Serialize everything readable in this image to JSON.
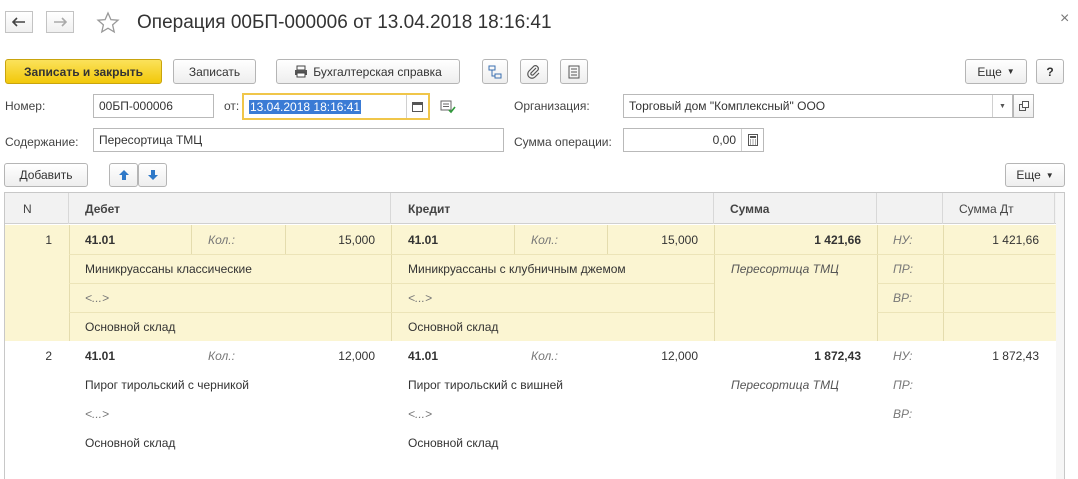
{
  "window": {
    "title": "Операция 00БП-000006 от 13.04.2018 18:16:41",
    "close": "×"
  },
  "toolbar": {
    "save_close": "Записать и закрыть",
    "save": "Записать",
    "accounting_report": "Бухгалтерская справка",
    "more": "Еще",
    "help": "?"
  },
  "form": {
    "number_label": "Номер:",
    "number_value": "00БП-000006",
    "date_label": "от:",
    "date_value": "13.04.2018 18:16:41",
    "org_label": "Организация:",
    "org_value": "Торговый дом \"Комплексный\" ООО",
    "content_label": "Содержание:",
    "content_value": "Пересортица ТМЦ",
    "sum_label": "Сумма операции:",
    "sum_value": "0,00"
  },
  "table_toolbar": {
    "add": "Добавить",
    "more": "Еще"
  },
  "table": {
    "headers": {
      "n": "N",
      "debit": "Дебет",
      "credit": "Кредит",
      "sum": "Сумма",
      "sum_dt": "Сумма Дт"
    },
    "qty_label": "Кол.:",
    "nu_label": "НУ:",
    "pr_label": "ПР:",
    "vr_label": "ВР:",
    "rows": [
      {
        "n": "1",
        "debit_account": "41.01",
        "debit_qty": "15,000",
        "debit_item": "Миникруассаны классические",
        "debit_sub2": "<...>",
        "debit_warehouse": "Основной склад",
        "credit_account": "41.01",
        "credit_qty": "15,000",
        "credit_item": "Миникруассаны с клубничным джемом",
        "credit_sub2": "<...>",
        "credit_warehouse": "Основной склад",
        "sum": "1 421,66",
        "sum_content": "Пересортица ТМЦ",
        "sum_dt": "1 421,66"
      },
      {
        "n": "2",
        "debit_account": "41.01",
        "debit_qty": "12,000",
        "debit_item": "Пирог тирольский с черникой",
        "debit_sub2": "<...>",
        "debit_warehouse": "Основной склад",
        "credit_account": "41.01",
        "credit_qty": "12,000",
        "credit_item": "Пирог тирольский с вишней",
        "credit_sub2": "<...>",
        "credit_warehouse": "Основной склад",
        "sum": "1 872,43",
        "sum_content": "Пересортица ТМЦ",
        "sum_dt": "1 872,43"
      }
    ]
  },
  "colors": {
    "primary_button": "#f2c80a",
    "selected_row": "#fbf5d2",
    "active_field_border": "#f0c64a"
  }
}
